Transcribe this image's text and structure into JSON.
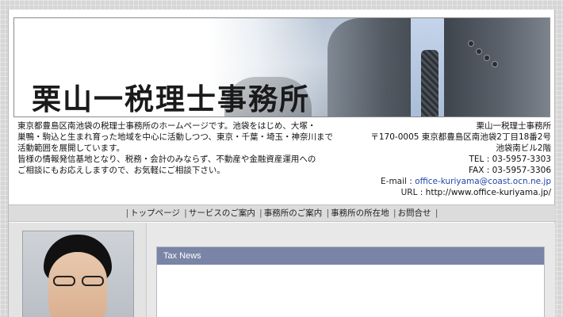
{
  "banner": {
    "title": "栗山一税理士事務所"
  },
  "intro": {
    "lines": [
      "東京都豊島区南池袋の税理士事務所のホームページです。池袋をはじめ、大塚・",
      "巣鴨・駒込と生まれ育った地域を中心に活動しつつ、東京・千葉・埼玉・神奈川まで",
      "活動範囲を展開しています。",
      "皆様の情報発信基地となり、税務・会計のみならず、不動産や金融資産運用への",
      "ご相談にもお応えしますので、お気軽にご相談下さい。"
    ]
  },
  "office": {
    "name": "栗山一税理士事務所",
    "address1": "〒170-0005 東京都豊島区南池袋2丁目18番2号",
    "address2": "池袋南ビル2階",
    "tel": "TEL : 03-5957-3303",
    "fax": "FAX : 03-5957-3306",
    "email_label": "E-mail : ",
    "email": "office-kuriyama@coast.ocn.ne.jp",
    "url_label": "URL : ",
    "url": "http://www.office-kuriyama.jp/"
  },
  "nav": {
    "items": [
      "トップページ",
      "サービスのご案内",
      "事務所のご案内",
      "事務所の所在地",
      "お問合せ"
    ]
  },
  "panel": {
    "title": "Tax News"
  }
}
